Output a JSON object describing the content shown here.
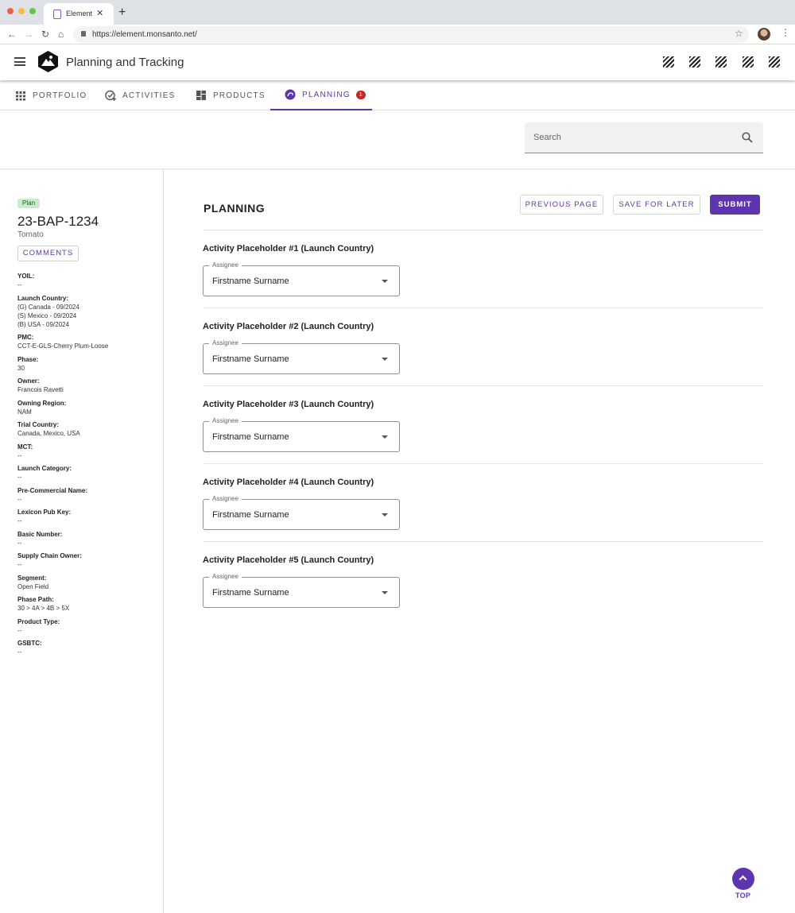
{
  "browser": {
    "tab_title": "Element",
    "tab_close": "✕",
    "new_tab": "+",
    "url": "https://element.monsanto.net/"
  },
  "app": {
    "title": "Planning and Tracking"
  },
  "nav": {
    "tabs": [
      {
        "label": "PORTFOLIO",
        "icon": "grid-icon"
      },
      {
        "label": "ACTIVITIES",
        "icon": "check-circle-add-icon"
      },
      {
        "label": "PRODUCTS",
        "icon": "dashboard-icon"
      },
      {
        "label": "PLANNING",
        "icon": "planning-icon",
        "badge": "1",
        "active": true
      }
    ]
  },
  "search": {
    "placeholder": "Search"
  },
  "sidebar": {
    "status": "Plan",
    "project_id": "23-BAP-1234",
    "crop": "Tomato",
    "comments_label": "COMMENTS",
    "properties": [
      {
        "label": "YOIL:",
        "values": [
          "--"
        ]
      },
      {
        "label": "Launch Country:",
        "values": [
          "(G) Canada - 09/2024",
          "(S) Mexico - 09/2024",
          "(B) USA - 09/2024"
        ]
      },
      {
        "label": "PMC:",
        "values": [
          "CCT-E-GLS-Cherry Plum-Loose"
        ]
      },
      {
        "label": "Phase:",
        "values": [
          "30"
        ]
      },
      {
        "label": "Owner:",
        "values": [
          "Francois Ravetti"
        ]
      },
      {
        "label": "Owning Region:",
        "values": [
          "NAM"
        ]
      },
      {
        "label": "Trial Country:",
        "values": [
          "Canada, Mexico, USA"
        ]
      },
      {
        "label": "MCT:",
        "values": [
          "--"
        ]
      },
      {
        "label": "Launch Category:",
        "values": [
          "--"
        ]
      },
      {
        "label": "Pre-Commercial Name:",
        "values": [
          "--"
        ]
      },
      {
        "label": "Lexicon Pub Key:",
        "values": [
          "--"
        ]
      },
      {
        "label": "Basic Number:",
        "values": [
          "--"
        ]
      },
      {
        "label": "Supply Chain Owner:",
        "values": [
          "--"
        ]
      },
      {
        "label": "Segment:",
        "values": [
          "Open Field"
        ]
      },
      {
        "label": "Phase Path:",
        "values": [
          "30 > 4A > 4B > 5X"
        ]
      },
      {
        "label": "Product Type:",
        "values": [
          "--"
        ]
      },
      {
        "label": "GSBTC:",
        "values": [
          "--"
        ]
      }
    ]
  },
  "main": {
    "title": "PLANNING",
    "previous_label": "PREVIOUS PAGE",
    "save_label": "SAVE FOR LATER",
    "submit_label": "SUBMIT",
    "activities": [
      {
        "title": "Activity Placeholder #1 (Launch Country)",
        "field_label": "Assignee",
        "value": "Firstname Surname"
      },
      {
        "title": "Activity Placeholder #2 (Launch Country)",
        "field_label": "Assignee",
        "value": "Firstname Surname"
      },
      {
        "title": "Activity Placeholder #3 (Launch Country)",
        "field_label": "Assignee",
        "value": "Firstname Surname"
      },
      {
        "title": "Activity Placeholder #4 (Launch Country)",
        "field_label": "Assignee",
        "value": "Firstname Surname"
      },
      {
        "title": "Activity Placeholder #5 (Launch Country)",
        "field_label": "Assignee",
        "value": "Firstname Surname"
      }
    ]
  },
  "top_button": {
    "label": "TOP"
  },
  "colors": {
    "accent": "#5e35b1",
    "badge": "#c62828",
    "plan_badge_bg": "#c8ecd0"
  }
}
